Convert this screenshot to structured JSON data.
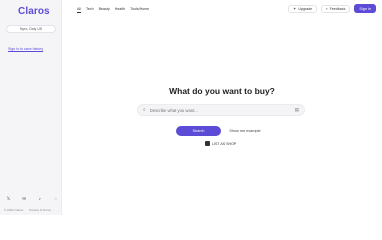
{
  "sidebar": {
    "logo": "Claros",
    "location_label": "Nyro, Daly US",
    "sign_in_link": "Sign in to save history",
    "social": [
      {
        "icon": "twitter-icon",
        "glyph": "𝕏"
      },
      {
        "icon": "mail-icon",
        "glyph": "✉"
      },
      {
        "icon": "tiktok-icon",
        "glyph": "♪"
      },
      {
        "icon": "globe-icon",
        "glyph": "◌"
      }
    ],
    "footer": [
      "© 2024 Claros",
      "Privacy & Terms"
    ]
  },
  "topnav": {
    "items": [
      {
        "label": "All",
        "active": true
      },
      {
        "label": "Tech"
      },
      {
        "label": "Beauty"
      },
      {
        "label": "Health"
      },
      {
        "label": "Tools/Home"
      }
    ]
  },
  "actions": {
    "upgrade": "Upgrade",
    "feedback": "Feedback",
    "signin": "Sign in"
  },
  "main": {
    "headline": "What do you want to buy?",
    "search_placeholder": "Describe what you want...",
    "search_button": "Search",
    "example_button": "Show me example",
    "list_link": "LIST AS SHOP"
  },
  "colors": {
    "accent": "#5b4bd6",
    "sidebar_bg": "#f5f5f7"
  }
}
